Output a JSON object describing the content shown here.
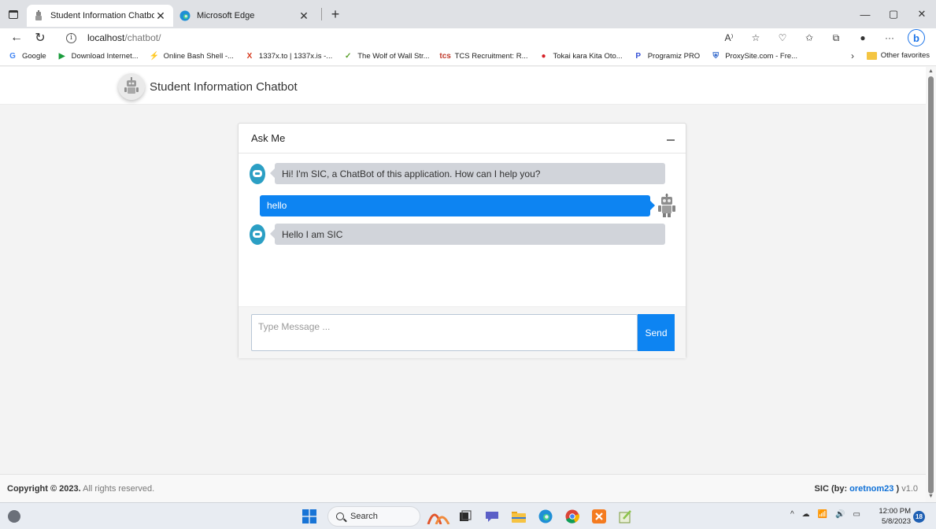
{
  "browser": {
    "tabs": [
      {
        "title": "Student Information Chatbot",
        "active": true
      },
      {
        "title": "Microsoft Edge",
        "active": false
      }
    ],
    "window_controls": {
      "minimize": "—",
      "maximize": "▢",
      "close": "✕"
    },
    "address": {
      "host": "localhost",
      "path": "/chatbot/",
      "info_glyph": "i"
    },
    "read_aloud_label": "A⁾",
    "favorites": [
      {
        "label": "Google",
        "icon": "G",
        "color": "#4285f4"
      },
      {
        "label": "Download Internet...",
        "icon": "▶",
        "color": "#1a9c3c"
      },
      {
        "label": "Online Bash Shell -...",
        "icon": "⚡",
        "color": "#3b2e8a"
      },
      {
        "label": "1337x.to | 1337x.is -...",
        "icon": "X",
        "color": "#d63b1f"
      },
      {
        "label": "The Wolf of Wall Str...",
        "icon": "✓",
        "color": "#5aa02c"
      },
      {
        "label": "TCS Recruitment: R...",
        "icon": "tcs",
        "color": "#c0392b"
      },
      {
        "label": "Tokai kara Kita Oto...",
        "icon": "●",
        "color": "#d61f26"
      },
      {
        "label": "Programiz PRO",
        "icon": "P",
        "color": "#3550d6"
      },
      {
        "label": "ProxySite.com - Fre...",
        "icon": "⛨",
        "color": "#2a62c9"
      }
    ],
    "other_favorites": "Other favorites",
    "more_glyph": "›"
  },
  "site": {
    "brand_title": "Student Information Chatbot"
  },
  "chat": {
    "title": "Ask Me",
    "messages": [
      {
        "from": "bot",
        "text": "Hi! I'm SIC, a ChatBot of this application. How can I help you?"
      },
      {
        "from": "user",
        "text": "hello"
      },
      {
        "from": "bot",
        "text": "Hello I am SIC"
      }
    ],
    "input_placeholder": "Type Message ...",
    "send_label": "Send"
  },
  "footer": {
    "copyright_prefix": "Copyright © 2023.",
    "copyright_suffix": " All rights reserved.",
    "sic_label": "SIC",
    "by_prefix": " (by: ",
    "author": "oretnom23",
    "by_suffix": " ) ",
    "version": "v1.0"
  },
  "taskbar": {
    "search_label": "Search",
    "time": "12:00 PM",
    "date": "5/8/2023",
    "notification_count": "18",
    "tray_chevron": "^"
  },
  "colors": {
    "accent": "#0d84f2",
    "bot_bubble": "#d1d4da",
    "bot_avatar": "#2b9fc4",
    "author_link": "#0d6fd6"
  }
}
